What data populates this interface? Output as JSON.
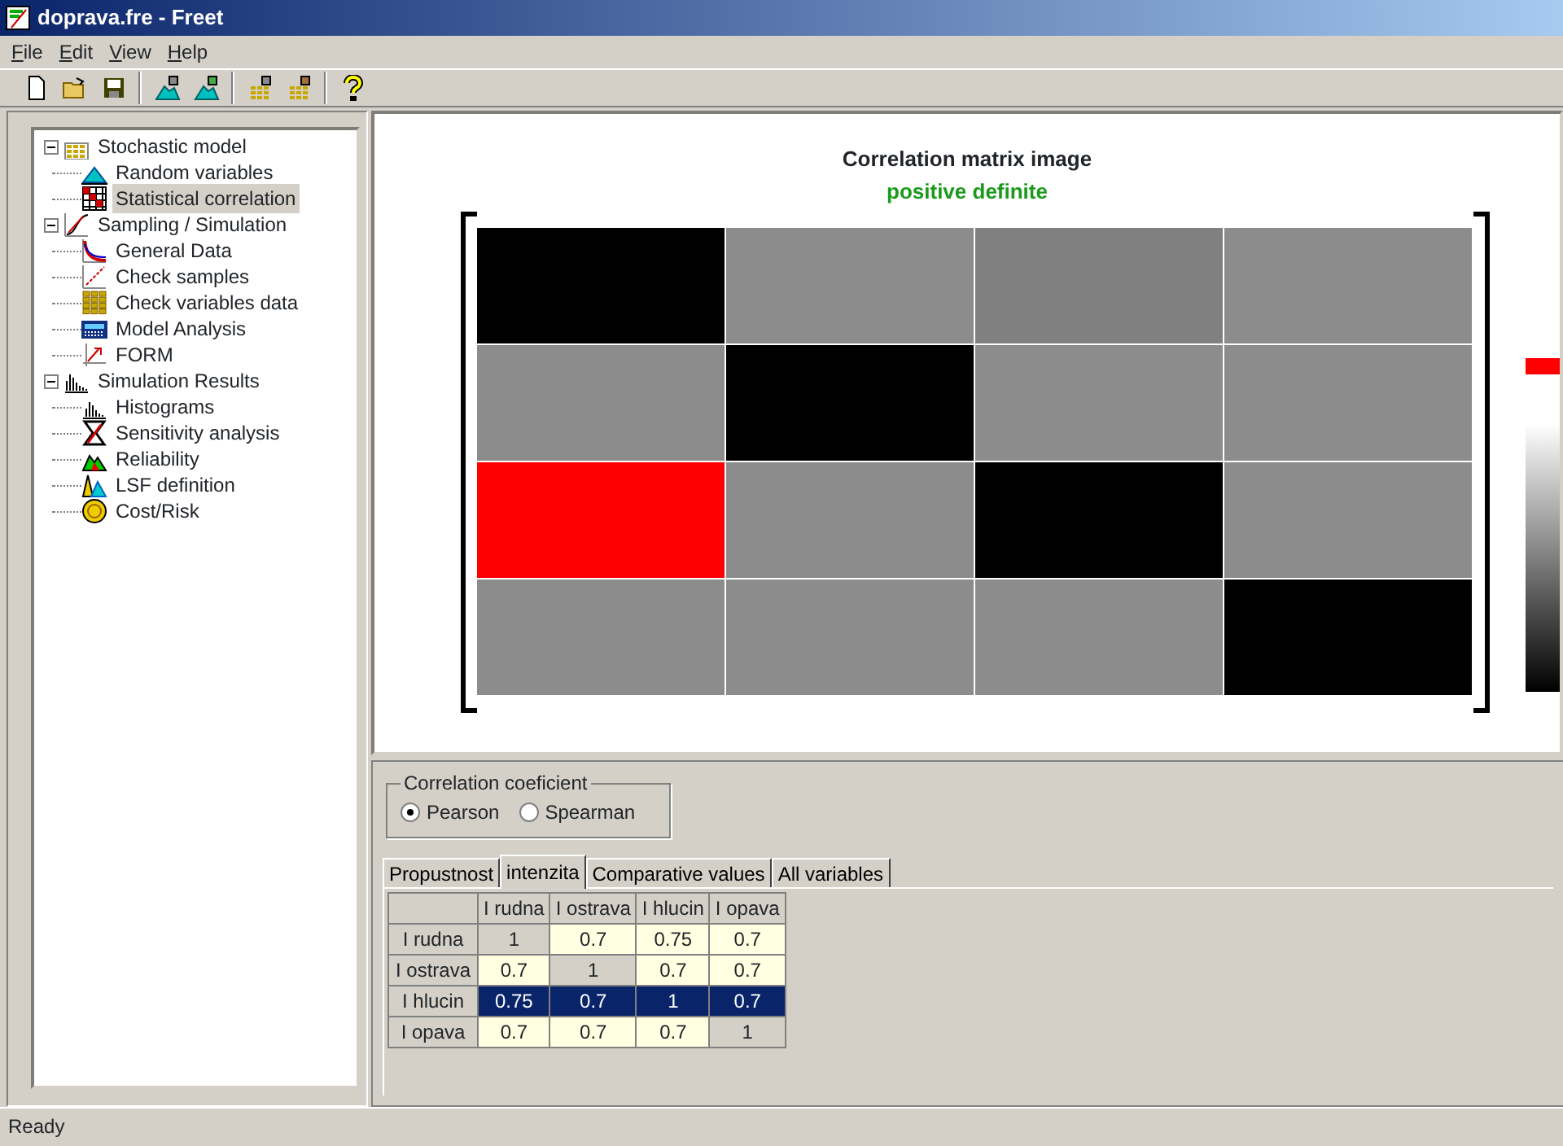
{
  "window": {
    "title": "doprava.fre - Freet"
  },
  "menu": [
    "File",
    "Edit",
    "View",
    "Help"
  ],
  "tree": [
    {
      "label": "Stochastic model",
      "expanded": true,
      "selected": false,
      "children": [
        {
          "label": "Random variables",
          "selected": false
        },
        {
          "label": "Statistical correlation",
          "selected": true
        }
      ]
    },
    {
      "label": "Sampling / Simulation",
      "expanded": true,
      "selected": false,
      "children": [
        {
          "label": "General Data",
          "selected": false
        },
        {
          "label": "Check samples",
          "selected": false
        },
        {
          "label": "Check variables data",
          "selected": false
        },
        {
          "label": "Model Analysis",
          "selected": false
        },
        {
          "label": "FORM",
          "selected": false
        }
      ]
    },
    {
      "label": "Simulation Results",
      "expanded": true,
      "selected": false,
      "children": [
        {
          "label": "Histograms",
          "selected": false
        },
        {
          "label": "Sensitivity analysis",
          "selected": false
        },
        {
          "label": "Reliability",
          "selected": false
        },
        {
          "label": "LSF definition",
          "selected": false
        },
        {
          "label": "Cost/Risk",
          "selected": false
        }
      ]
    }
  ],
  "matrix_image": {
    "title": "Correlation matrix image",
    "status": "positive definite",
    "rows": [
      [
        {
          "color": "#000000"
        },
        {
          "color": "#8c8c8c"
        },
        {
          "color": "#808080"
        },
        {
          "color": "#8c8c8c"
        }
      ],
      [
        {
          "color": "#8c8c8c"
        },
        {
          "color": "#000000"
        },
        {
          "color": "#8c8c8c"
        },
        {
          "color": "#8c8c8c"
        }
      ],
      [
        {
          "color": "#ff0000"
        },
        {
          "color": "#8c8c8c"
        },
        {
          "color": "#000000"
        },
        {
          "color": "#8c8c8c"
        }
      ],
      [
        {
          "color": "#8c8c8c"
        },
        {
          "color": "#8c8c8c"
        },
        {
          "color": "#8c8c8c"
        },
        {
          "color": "#000000"
        }
      ]
    ]
  },
  "coefficient": {
    "label": "Correlation coeficient",
    "options": [
      {
        "label": "Pearson",
        "selected": true
      },
      {
        "label": "Spearman",
        "selected": false
      }
    ]
  },
  "tabs": [
    {
      "label": "Propustnost",
      "selected": false
    },
    {
      "label": "intenzita",
      "selected": true
    },
    {
      "label": "Comparative values",
      "selected": false
    },
    {
      "label": "All variables",
      "selected": false
    }
  ],
  "grid": {
    "columns": [
      "I rudna",
      "I ostrava",
      "I hlucin",
      "I opava"
    ],
    "rows": [
      {
        "label": "I rudna",
        "selected": false,
        "cells": [
          {
            "text": "1",
            "kind": "diagonal"
          },
          {
            "text": "0.7",
            "kind": "value"
          },
          {
            "text": "0.75",
            "kind": "value"
          },
          {
            "text": "0.7",
            "kind": "value"
          }
        ]
      },
      {
        "label": "I ostrava",
        "selected": false,
        "cells": [
          {
            "text": "0.7",
            "kind": "value"
          },
          {
            "text": "1",
            "kind": "diagonal"
          },
          {
            "text": "0.7",
            "kind": "value"
          },
          {
            "text": "0.7",
            "kind": "value"
          }
        ]
      },
      {
        "label": "I hlucin",
        "selected": true,
        "cells": [
          {
            "text": "0.75",
            "kind": "value"
          },
          {
            "text": "0.7",
            "kind": "value"
          },
          {
            "text": "1",
            "kind": "diagonal"
          },
          {
            "text": "0.7",
            "kind": "value"
          }
        ]
      },
      {
        "label": "I opava",
        "selected": false,
        "cells": [
          {
            "text": "0.7",
            "kind": "value"
          },
          {
            "text": "0.7",
            "kind": "value"
          },
          {
            "text": "0.7",
            "kind": "value"
          },
          {
            "text": "1",
            "kind": "diagonal"
          }
        ]
      }
    ]
  },
  "status_bar": "Ready"
}
